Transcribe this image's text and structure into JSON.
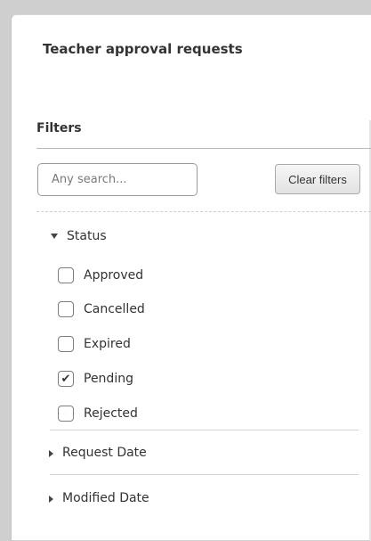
{
  "panel": {
    "title": "Teacher approval requests"
  },
  "filters": {
    "heading": "Filters",
    "search": {
      "placeholder": "Any search...",
      "value": ""
    },
    "clear_label": "Clear filters",
    "status": {
      "label": "Status",
      "expanded": true,
      "options": [
        {
          "label": "Approved",
          "checked": false
        },
        {
          "label": "Cancelled",
          "checked": false
        },
        {
          "label": "Expired",
          "checked": false
        },
        {
          "label": "Pending",
          "checked": true
        },
        {
          "label": "Rejected",
          "checked": false
        }
      ]
    },
    "request_date": {
      "label": "Request Date",
      "expanded": false
    },
    "modified_date": {
      "label": "Modified Date",
      "expanded": false
    }
  },
  "icons": {
    "check_glyph": "✔"
  }
}
